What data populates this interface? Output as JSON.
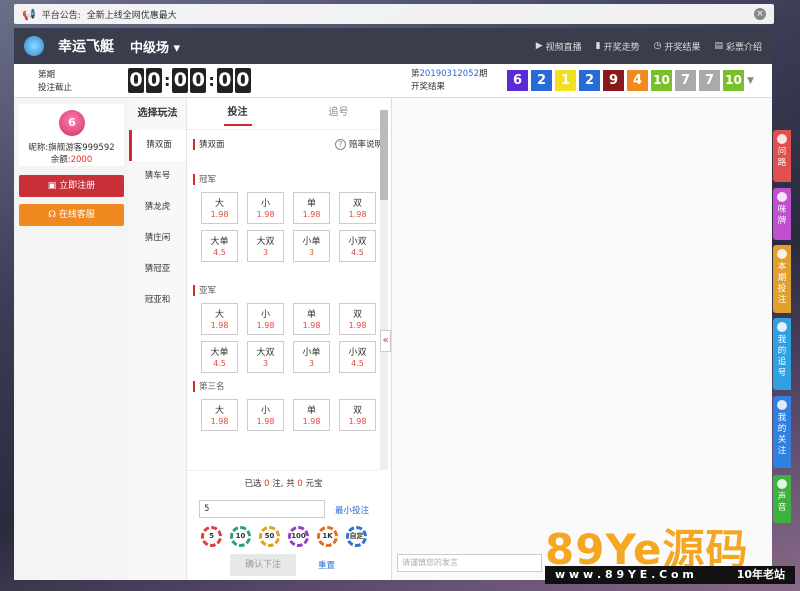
{
  "notice": {
    "label": "平台公告:",
    "text": "全新上线全网优惠最大"
  },
  "header": {
    "brand": "幸运飞艇",
    "level": "中级场 ▾",
    "nav": [
      "视频直播",
      "开奖走势",
      "开奖结果",
      "彩票介绍"
    ]
  },
  "issue": {
    "line1": "第期",
    "line2": "投注截止",
    "timer": [
      "0",
      "0",
      "0",
      "0",
      "0",
      "0"
    ]
  },
  "draw": {
    "prefix": "第",
    "number": "20190312052",
    "suffix": "期",
    "label": "开奖结果",
    "balls": [
      {
        "n": "6",
        "color": "#5b2bd6"
      },
      {
        "n": "2",
        "color": "#2a6ad8"
      },
      {
        "n": "1",
        "color": "#f0e020"
      },
      {
        "n": "2",
        "color": "#2a6ad8"
      },
      {
        "n": "9",
        "color": "#8a1a1a"
      },
      {
        "n": "4",
        "color": "#f08a20"
      },
      {
        "n": "10",
        "color": "#7ac02a"
      },
      {
        "n": "7",
        "color": "#aaaaaa"
      },
      {
        "n": "7",
        "color": "#aaaaaa"
      },
      {
        "n": "10",
        "color": "#7ac02a"
      }
    ]
  },
  "user": {
    "avatar": "6",
    "nick_label": "昵称:",
    "nick": "旗舰游客999592",
    "bal_label": "余额:",
    "balance": "2000",
    "register": "立即注册",
    "service": "在线客服"
  },
  "play": {
    "title": "选择玩法",
    "items": [
      "猜双面",
      "猜车号",
      "猜龙虎",
      "猜庄闲",
      "猜冠亚",
      "冠亚和"
    ]
  },
  "tabs": [
    "投注",
    "追号"
  ],
  "bet": {
    "subtitle": "猜双面",
    "help": "赔率说明",
    "sections": [
      {
        "name": "冠军",
        "cells": [
          [
            "大",
            "1.98"
          ],
          [
            "小",
            "1.98"
          ],
          [
            "单",
            "1.98"
          ],
          [
            "双",
            "1.98"
          ],
          [
            "大单",
            "4.5"
          ],
          [
            "大双",
            "3"
          ],
          [
            "小单",
            "3"
          ],
          [
            "小双",
            "4.5"
          ]
        ]
      },
      {
        "name": "亚军",
        "cells": [
          [
            "大",
            "1.98"
          ],
          [
            "小",
            "1.98"
          ],
          [
            "单",
            "1.98"
          ],
          [
            "双",
            "1.98"
          ],
          [
            "大单",
            "4.5"
          ],
          [
            "大双",
            "3"
          ],
          [
            "小单",
            "3"
          ],
          [
            "小双",
            "4.5"
          ]
        ]
      },
      {
        "name": "第三名",
        "cells": [
          [
            "大",
            "1.98"
          ],
          [
            "小",
            "1.98"
          ],
          [
            "单",
            "1.98"
          ],
          [
            "双",
            "1.98"
          ]
        ]
      }
    ]
  },
  "summary": {
    "a": "已选",
    "count": "0",
    "b": "注, 共",
    "total": "0",
    "c": "元宝",
    "amount": "5",
    "min": "最小投注",
    "chips": [
      "5",
      "10",
      "50",
      "100",
      "1K",
      "自定"
    ],
    "confirm": "确认下注",
    "reset": "重置"
  },
  "chat": {
    "placeholder": "请谨慎您的发言"
  },
  "side": [
    {
      "label": "问路",
      "color": "#e05050"
    },
    {
      "label": "咪牌",
      "color": "#c050d0"
    },
    {
      "label": "本期投注",
      "color": "#e0a030"
    },
    {
      "label": "我的追号",
      "color": "#30a0e0"
    },
    {
      "label": "我的关注",
      "color": "#3080e0"
    },
    {
      "label": "声音",
      "color": "#40b040"
    }
  ],
  "watermark": {
    "big1": "89",
    "big2": "Ye",
    "big3": "源码",
    "url": "w w w . 8 9 Y E . C o m",
    "tag": "10年老站"
  }
}
